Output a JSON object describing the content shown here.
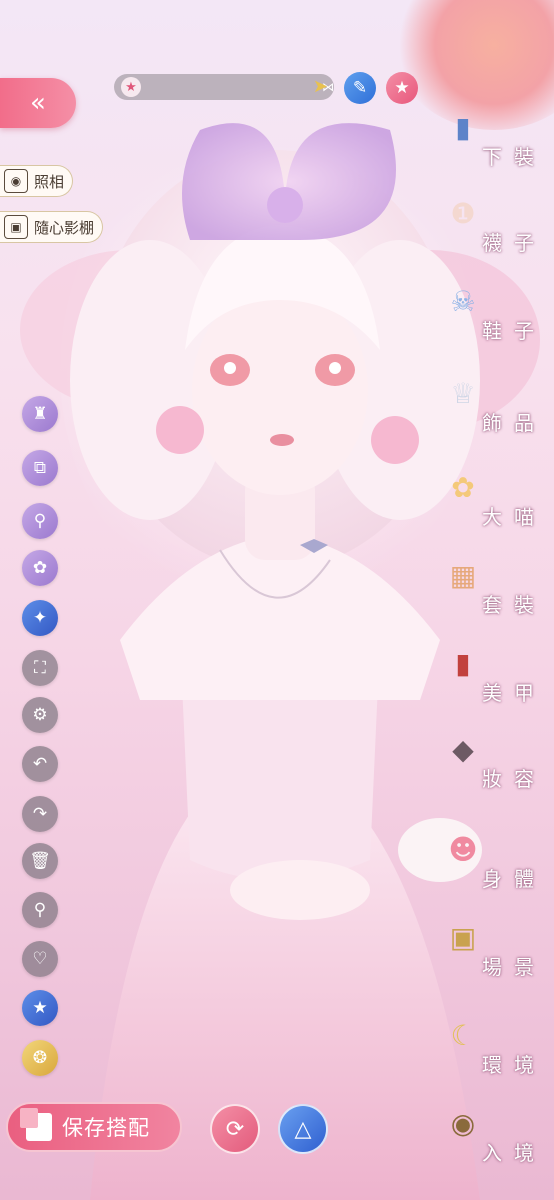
{
  "top": {
    "back_icon": "double-chevron-left",
    "progress_star_icon": "star",
    "progress_knot_icon": "bow-knot",
    "progress_arrow_icon": "arrow-right",
    "pencil_icon": "pencil",
    "star_icon": "star"
  },
  "left_pills": {
    "photo_label": "照相",
    "studio_label": "隨心影棚"
  },
  "left_tools": [
    "figure-icon",
    "layers-icon",
    "search-user-icon",
    "palette-icon",
    "star-burst-icon",
    "fullscreen-icon",
    "settings-icon",
    "undo-icon",
    "redo-icon",
    "trash-icon",
    "search-icon",
    "heart-icon",
    "star-badge-icon",
    "cat-fox-icon"
  ],
  "categories": [
    {
      "label": "下裝",
      "icon": "jeans"
    },
    {
      "label": "襪子",
      "icon": "socks"
    },
    {
      "label": "鞋子",
      "icon": "shoe"
    },
    {
      "label": "飾品",
      "icon": "tiara"
    },
    {
      "label": "大喵",
      "icon": "cat"
    },
    {
      "label": "套裝",
      "icon": "outfit-set"
    },
    {
      "label": "美甲",
      "icon": "nail-polish"
    },
    {
      "label": "妝容",
      "icon": "makeup-palette"
    },
    {
      "label": "身體",
      "icon": "body-figure"
    },
    {
      "label": "場景",
      "icon": "scene-frame"
    },
    {
      "label": "環境",
      "icon": "moon-environment"
    },
    {
      "label": "入境",
      "icon": "portal"
    }
  ],
  "bottom": {
    "save_label": "保存搭配",
    "b1_icon": "rotate-figure",
    "b2_icon": "dress-outfit"
  },
  "colors": {
    "accent_pink": "#ea5f80",
    "accent_blue": "#3358c4"
  }
}
